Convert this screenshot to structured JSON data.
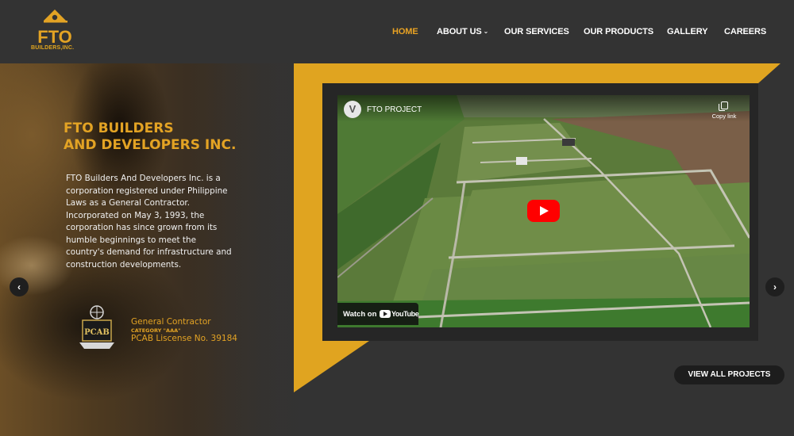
{
  "brand": {
    "name": "FTO",
    "sub": "BUILDERS,INC.",
    "color": "#e3a324"
  },
  "nav": {
    "items": [
      {
        "label": "HOME",
        "active": true
      },
      {
        "label": "ABOUT US",
        "has_dropdown": true
      },
      {
        "label": "OUR SERVICES"
      },
      {
        "label": "OUR PRODUCTS"
      },
      {
        "label": "GALLERY"
      },
      {
        "label": "CAREERS"
      }
    ],
    "dropdown_glyph": "⌄"
  },
  "hero": {
    "title_line1": "FTO BUILDERS",
    "title_line2": "AND DEVELOPERS INC.",
    "description": "FTO Builders And Developers Inc. is a corporation registered under Philippine Laws as a General Contractor. Incorporated on May 3, 1993, the corporation has since grown from its humble beginnings to meet the country's demand for infrastructure and construction developments.",
    "badge_text": "PCAB",
    "credential_label": "General Contractor",
    "credential_category": "CATEGORY \"AAA\"",
    "credential_license": "PCAB Liscense No. 39184"
  },
  "video": {
    "title": "FTO PROJECT",
    "channel_initial": "V",
    "copy_label": "Copy link",
    "watch_label": "Watch on",
    "platform": "YouTube"
  },
  "controls": {
    "prev_glyph": "‹",
    "next_glyph": "›",
    "view_all_label": "VIEW ALL PROJECTS"
  },
  "colors": {
    "accent": "#e3a324",
    "frame": "#e0a420",
    "background": "#333333",
    "dark_panel": "#262626"
  }
}
